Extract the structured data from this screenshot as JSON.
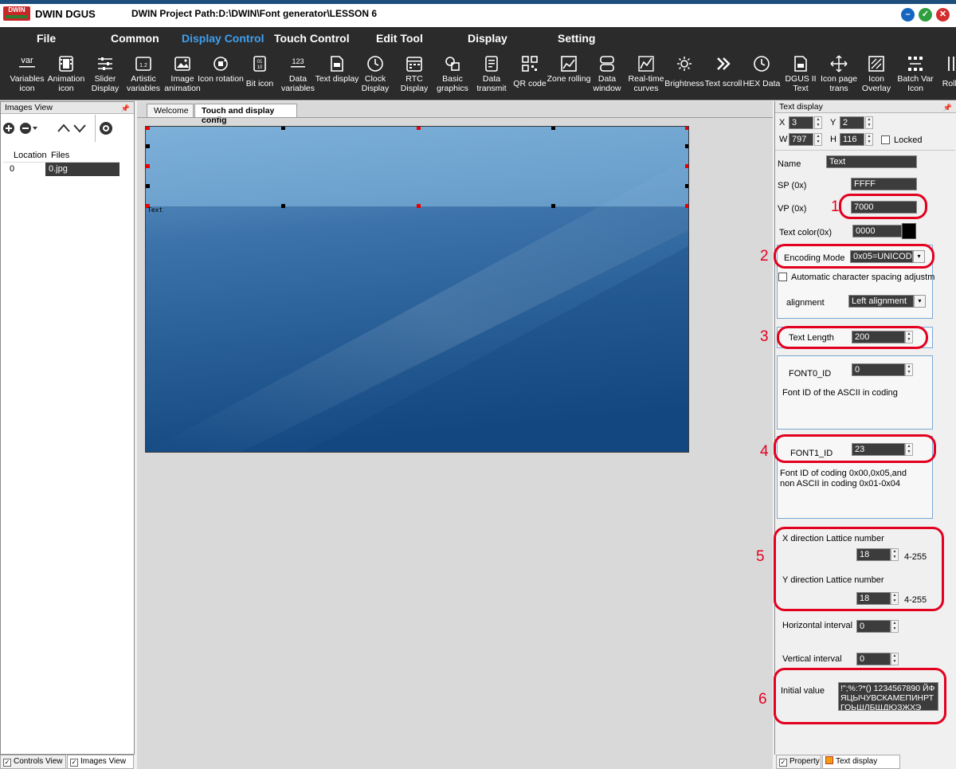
{
  "window": {
    "logo_text": "DWIN",
    "app_name": "DWIN DGUS",
    "project_path": "DWIN Project Path:D:\\DWIN\\Font generator\\LESSON 6"
  },
  "menu": [
    {
      "label": "File"
    },
    {
      "label": "Common"
    },
    {
      "label": "Display Control",
      "active": true
    },
    {
      "label": "Touch Control"
    },
    {
      "label": "Edit Tool"
    },
    {
      "label": "Display"
    },
    {
      "label": "Setting"
    }
  ],
  "toolbar": [
    {
      "label": "Variables icon",
      "icon": "var-icon"
    },
    {
      "label": "Animation icon",
      "icon": "film-icon"
    },
    {
      "label": "Slider Display",
      "icon": "slider-icon"
    },
    {
      "label": "Artistic variables",
      "icon": "artistic-icon"
    },
    {
      "label": "Image animation",
      "icon": "image-icon"
    },
    {
      "label": "Icon rotation",
      "icon": "rotation-icon"
    },
    {
      "label": "Bit icon",
      "icon": "bit-icon"
    },
    {
      "label": "Data variables",
      "icon": "data-123-icon"
    },
    {
      "label": "Text display",
      "icon": "text-file-icon"
    },
    {
      "label": "Clock Display",
      "icon": "clock-icon"
    },
    {
      "label": "RTC Display",
      "icon": "calendar-icon"
    },
    {
      "label": "Basic graphics",
      "icon": "shapes-icon"
    },
    {
      "label": "Data transmit",
      "icon": "transmit-icon"
    },
    {
      "label": "QR code",
      "icon": "qr-code-icon"
    },
    {
      "label": "Zone rolling",
      "icon": "zone-roll-icon"
    },
    {
      "label": "Data window",
      "icon": "data-window-icon"
    },
    {
      "label": "Real-time curves",
      "icon": "curve-icon"
    },
    {
      "label": "Brightness",
      "icon": "brightness-icon"
    },
    {
      "label": "Text scroll",
      "icon": "chevrons-right-icon"
    },
    {
      "label": "HEX Data",
      "icon": "hex-clock-icon"
    },
    {
      "label": "DGUS II Text",
      "icon": "dgus-text-icon"
    },
    {
      "label": "Icon page trans",
      "icon": "move-arrows-icon"
    },
    {
      "label": "Icon Overlay",
      "icon": "overlay-icon"
    },
    {
      "label": "Batch Var Icon",
      "icon": "batch-icon"
    },
    {
      "label": "Roll C",
      "icon": "roll-icon"
    }
  ],
  "images_view": {
    "title": "Images View",
    "columns": [
      "Location",
      "Files"
    ],
    "rows": [
      {
        "location": "0",
        "file": "0.jpg"
      }
    ]
  },
  "bottom_tabs_left": [
    {
      "label": "Controls View"
    },
    {
      "label": "Images View",
      "active": true
    }
  ],
  "bottom_tabs_right": [
    {
      "label": "Property"
    },
    {
      "label": "Text display",
      "active": true
    }
  ],
  "doc_tabs": [
    {
      "label": "Welcome"
    },
    {
      "label": "Touch and display config",
      "active": true
    }
  ],
  "canvas": {
    "control_label": "Text"
  },
  "props": {
    "title": "Text display",
    "x_label": "X",
    "x": "3",
    "y_label": "Y",
    "y": "2",
    "w_label": "W",
    "w": "797",
    "h_label": "H",
    "h": "116",
    "locked_label": "Locked",
    "name_label": "Name",
    "name": "Text",
    "sp_label": "SP (0x)",
    "sp": "FFFF",
    "vp_label": "VP (0x)",
    "vp": "7000",
    "text_color_label": "Text color(0x)",
    "text_color": "0000",
    "encoding_label": "Encoding Mode",
    "encoding": "0x05=UNICODE",
    "auto_spacing_label": "Automatic character spacing adjustm",
    "alignment_label": "alignment",
    "alignment": "Left alignment",
    "text_length_label": "Text Length",
    "text_length": "200",
    "font0_label": "FONT0_ID",
    "font0": "0",
    "font0_desc": "Font ID of the ASCII in coding",
    "font1_label": "FONT1_ID",
    "font1": "23",
    "font1_desc_1": "Font ID of coding 0x00,0x05,and",
    "font1_desc_2": "non ASCII in coding 0x01-0x04",
    "x_lattice_label": "X direction Lattice number",
    "x_lattice": "18",
    "y_lattice_label": "Y direction Lattice number",
    "y_lattice": "18",
    "lattice_range": "4-255",
    "h_interval_label": "Horizontal interval",
    "h_interval": "0",
    "v_interval_label": "Vertical interval",
    "v_interval": "0",
    "initial_value_label": "Initial value",
    "initial_value": "!\";%:?*() 1234567890 ЙФЯЦЫЧУВСКАМЕПИНРТГОЬШЛБЩДЮЗЖХЭ"
  },
  "annotations": [
    "1",
    "2",
    "3",
    "4",
    "5",
    "6"
  ],
  "colors": {
    "menu_bg": "#2b2b2b",
    "active_menu": "#3fa0ee",
    "annotation_red": "#e3001f",
    "canvas_top": "#78aed6",
    "canvas_bottom": "#154a83"
  }
}
